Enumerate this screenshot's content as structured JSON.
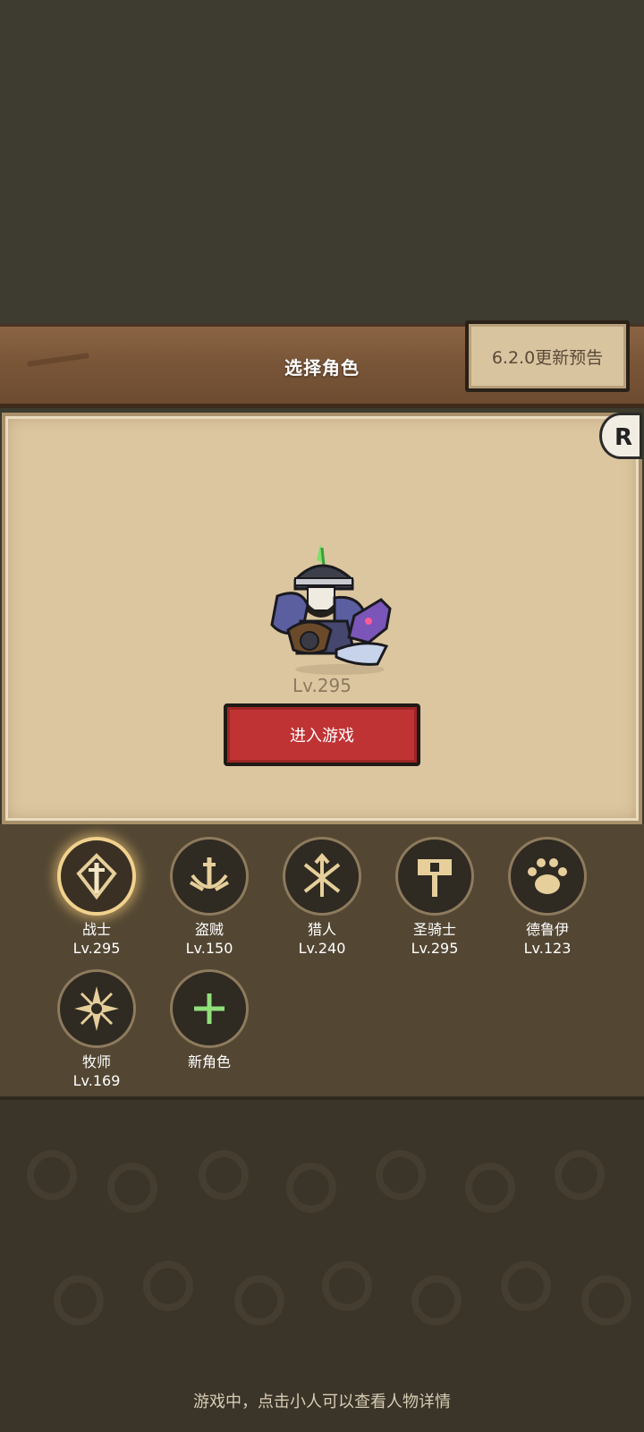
{
  "header": {
    "title": "选择角色",
    "update_button": "6.2.0更新预告"
  },
  "hero": {
    "level": "Lv.295",
    "enter_button": "进入游戏"
  },
  "classes": [
    {
      "name": "战士",
      "level": "Lv.295",
      "icon": "warrior-icon",
      "selected": true
    },
    {
      "name": "盗贼",
      "level": "Lv.150",
      "icon": "rogue-icon",
      "selected": false
    },
    {
      "name": "猎人",
      "level": "Lv.240",
      "icon": "hunter-icon",
      "selected": false
    },
    {
      "name": "圣骑士",
      "level": "Lv.295",
      "icon": "paladin-icon",
      "selected": false
    },
    {
      "name": "德鲁伊",
      "level": "Lv.123",
      "icon": "druid-icon",
      "selected": false
    },
    {
      "name": "牧师",
      "level": "Lv.169",
      "icon": "priest-icon",
      "selected": false
    },
    {
      "name": "新角色",
      "icon": "plus-icon"
    }
  ],
  "hint": "游戏中，点击小人可以查看人物详情",
  "colors": {
    "icon_gold": "#e6cf9a",
    "plus_green": "#8fe07a",
    "enter_red": "#c03334"
  }
}
